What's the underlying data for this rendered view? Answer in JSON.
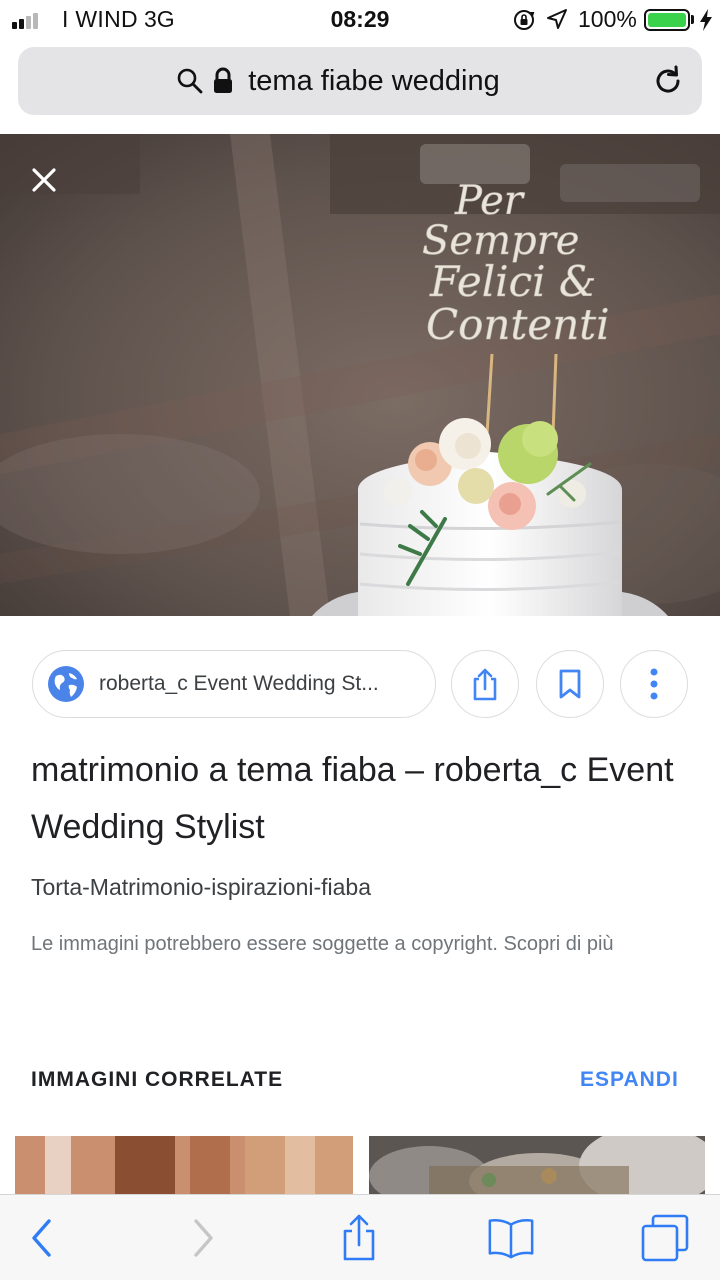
{
  "status_bar": {
    "carrier": "I WIND",
    "network": "3G",
    "time": "08:29",
    "battery_percent": "100%",
    "battery_level": 1.0,
    "icons": [
      "signal-icon",
      "rotation-lock-icon",
      "location-arrow-icon",
      "battery-icon",
      "charging-bolt-icon"
    ]
  },
  "address_bar": {
    "query": "tema fiabe wedding",
    "icons": [
      "search-icon",
      "lock-icon",
      "reload-icon"
    ]
  },
  "viewer": {
    "close_icon": "close-icon",
    "image_subject": "wedding-cake-with-topper",
    "topper_lettering": [
      "Per",
      "Sempre",
      "Felici &",
      "Contenti"
    ]
  },
  "source": {
    "label": "roberta_c Event Wedding St...",
    "icon": "globe-icon"
  },
  "actions": [
    {
      "name": "share-icon"
    },
    {
      "name": "bookmark-icon"
    },
    {
      "name": "more-vertical-icon"
    }
  ],
  "result": {
    "title": "matrimonio a tema fiaba – roberta_c Event Wedding Stylist",
    "filename": "Torta-Matrimonio-ispirazioni-fiaba",
    "copyright_notice": "Le immagini potrebbero essere soggette a copyright. Scopri di più"
  },
  "related": {
    "heading": "IMMAGINI CORRELATE",
    "expand_label": "ESPANDI"
  },
  "toolbar": {
    "icons": [
      "back-icon",
      "forward-icon",
      "share-icon",
      "bookmarks-icon",
      "tabs-icon"
    ]
  },
  "colors": {
    "accent_blue": "#4285f4",
    "ios_blue": "#2f7cf6",
    "battery_green": "#3ad24a",
    "url_bar_bg": "#e4e4e6",
    "chip_border": "#dadce0"
  }
}
